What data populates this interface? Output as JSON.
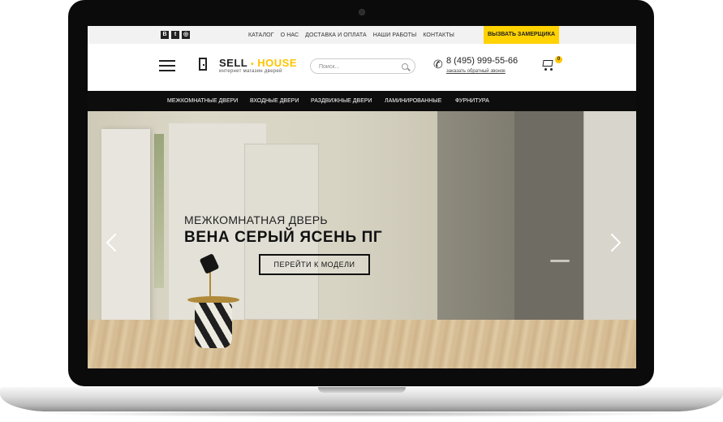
{
  "topbar": {
    "social": [
      "В",
      "t",
      "◎"
    ],
    "nav": [
      "КАТАЛОГ",
      "О НАС",
      "ДОСТАВКА И ОПЛАТА",
      "НАШИ РАБОТЫ",
      "КОНТАКТЫ"
    ],
    "measure_button": "ВЫЗВАТЬ ЗАМЕРЩИКА"
  },
  "header": {
    "logo_sell": "SELL",
    "logo_dot": "•",
    "logo_house": "HOUSE",
    "logo_subtitle": "интернет магазин дверей",
    "search_placeholder": "Поиск...",
    "phone": "8 (495) 999-55-66",
    "callback": "заказать обратный звонок",
    "cart_count": "0"
  },
  "menu": {
    "items": [
      "МЕЖКОМНАТНЫЕ ДВЕРИ",
      "ВХОДНЫЕ ДВЕРИ",
      "РАЗДВИЖНЫЕ ДВЕРИ",
      "ЛАМИНИРОВАННЫЕ",
      "ФУРНИТУРА"
    ]
  },
  "hero": {
    "subtitle": "МЕЖКОМНАТНАЯ ДВЕРЬ",
    "title": "ВЕНА СЕРЫЙ ЯСЕНЬ ПГ",
    "button": "ПЕРЕЙТИ К МОДЕЛИ"
  },
  "colors": {
    "accent": "#ffd200",
    "menu_bg": "#0d0d0d"
  },
  "icons": [
    "menu-icon",
    "door-logo-icon",
    "search-icon",
    "phone-icon",
    "cart-icon",
    "chevron-left-icon",
    "chevron-right-icon"
  ]
}
